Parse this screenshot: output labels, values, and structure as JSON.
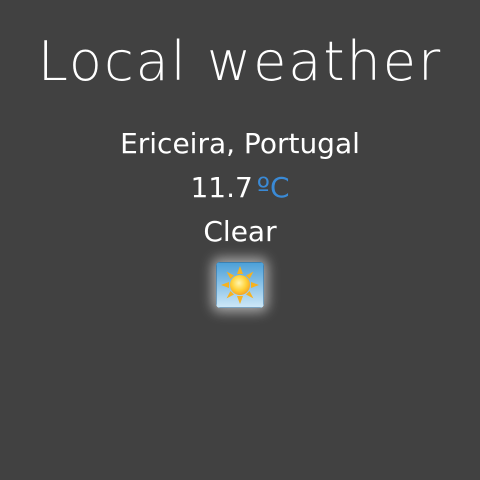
{
  "app": {
    "title": "Local weather"
  },
  "weather": {
    "location": "Ericeira, Portugal",
    "temperature": "11.7",
    "unit": "ºC",
    "condition": "Clear",
    "icon": "sun-icon"
  },
  "colors": {
    "background": "#414141",
    "text": "#ffffff",
    "unit_accent": "#3a8ad6"
  }
}
